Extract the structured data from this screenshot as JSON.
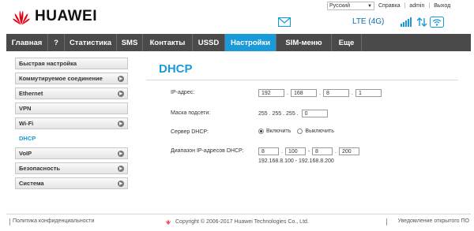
{
  "brand": {
    "name": "HUAWEI"
  },
  "header": {
    "language": "Русский",
    "links": [
      "Справка",
      "admin",
      "Выход"
    ],
    "network": "LTE (4G)"
  },
  "nav": {
    "items": [
      "Главная",
      "?",
      "Статистика",
      "SMS",
      "Контакты",
      "USSD",
      "Настройки",
      "SIM-меню",
      "Еще"
    ],
    "active_index": 6
  },
  "sidebar": {
    "items": [
      {
        "label": "Быстрая настройка",
        "arrow": false
      },
      {
        "label": "Коммутируемое соединение",
        "arrow": true
      },
      {
        "label": "Ethernet",
        "arrow": true
      },
      {
        "label": "VPN",
        "arrow": false
      },
      {
        "label": "Wi-Fi",
        "arrow": true
      },
      {
        "label": "DHCP",
        "arrow": false,
        "active": true
      },
      {
        "label": "VoIP",
        "arrow": true
      },
      {
        "label": "Безопасность",
        "arrow": true
      },
      {
        "label": "Система",
        "arrow": true
      }
    ]
  },
  "main": {
    "title": "DHCP",
    "ip_label": "IP-адрес:",
    "ip": [
      "192",
      "168",
      "8",
      "1"
    ],
    "mask_label": "Маска подсети:",
    "mask_static": "255 . 255 . 255 .",
    "mask_last": "0",
    "dhcp_label": "Сервер DHCP:",
    "dhcp_on": "Включить",
    "dhcp_off": "Выключить",
    "range_label": "Диапазон IP-адресов DHCP:",
    "range_start": "8",
    "range_start2": "100",
    "range_dash": "-",
    "range_end": "8",
    "range_end2": "200",
    "range_text": "192.168.8.100 - 192.168.8.200"
  },
  "footer": {
    "privacy": "Политика конфиденциальности",
    "copyright": "Copyright © 2006-2017 Huawei Technologies Co., Ltd.",
    "open_source": "Уведомление открытого ПО"
  },
  "colors": {
    "accent": "#1a9ad8",
    "navbar": "#4a4a4a",
    "logo": "#e60012"
  }
}
